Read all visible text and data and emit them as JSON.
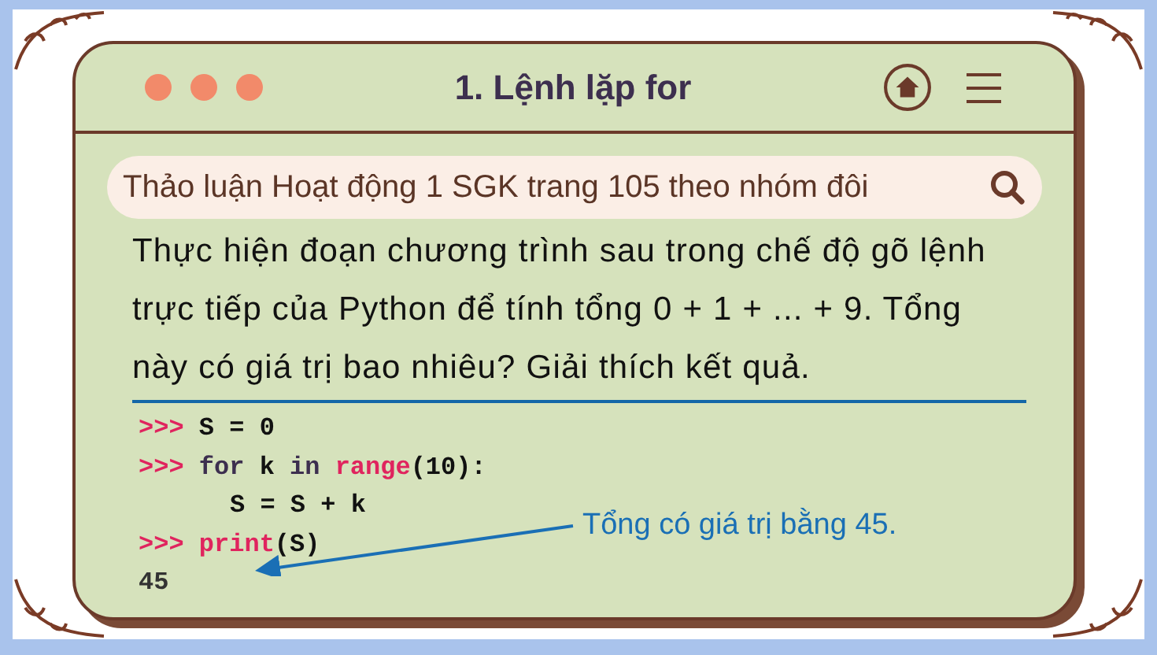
{
  "window": {
    "title": "1. Lệnh lặp for"
  },
  "search": {
    "value": "Thảo luận Hoạt động 1 SGK trang 105 theo nhóm đôi"
  },
  "paragraph": "Thực hiện đoạn chương trình sau trong chế độ gõ lệnh trực tiếp của Python để tính tổng 0 + 1 + ... + 9. Tổng này có giá trị bao nhiêu? Giải thích kết quả.",
  "code_lines": [
    {
      "tokens": [
        {
          "kind": "prompt",
          "text": ">>>"
        },
        {
          "kind": "plain",
          "text": "S = 0"
        }
      ]
    },
    {
      "tokens": [
        {
          "kind": "prompt",
          "text": ">>>"
        },
        {
          "kind": "keyword",
          "text": "for"
        },
        {
          "kind": "plain",
          "text": "k"
        },
        {
          "kind": "keyword",
          "text": "in"
        },
        {
          "kind": "builtin",
          "text": "range"
        },
        {
          "kind": "plain",
          "text": "(10):",
          "joined": true
        }
      ]
    },
    {
      "indented": true,
      "tokens": [
        {
          "kind": "plain",
          "text": "S = S + k"
        }
      ]
    },
    {
      "tokens": [
        {
          "kind": "prompt",
          "text": ">>>"
        },
        {
          "kind": "builtin",
          "text": "print"
        },
        {
          "kind": "plain",
          "text": "(S)",
          "joined": true
        }
      ]
    },
    {
      "tokens": [
        {
          "kind": "output",
          "text": "45"
        }
      ]
    }
  ],
  "annotation": "Tổng có giá trị bằng 45."
}
